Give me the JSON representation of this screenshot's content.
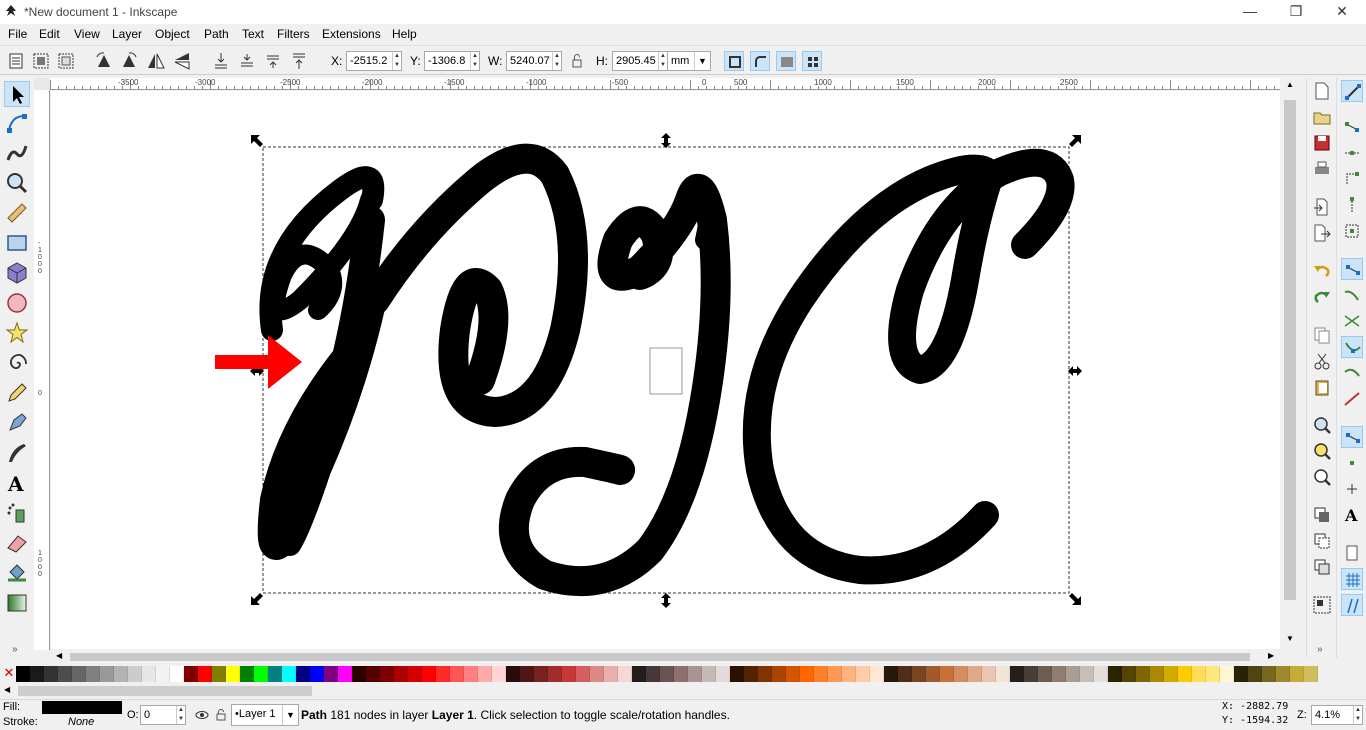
{
  "window": {
    "title": "*New document 1 - Inkscape",
    "minimize": "—",
    "maximize": "❐",
    "close": "✕"
  },
  "menu": [
    "File",
    "Edit",
    "View",
    "Layer",
    "Object",
    "Path",
    "Text",
    "Filters",
    "Extensions",
    "Help"
  ],
  "controls": {
    "x_label": "X:",
    "x_value": "-2515.2",
    "y_label": "Y:",
    "y_value": "-1306.8",
    "w_label": "W:",
    "w_value": "5240.07",
    "h_label": "H:",
    "h_value": "2905.45",
    "unit": "mm"
  },
  "ruler": {
    "h_labels": [
      "-3500",
      "-3000",
      "-2500",
      "-2000",
      "-1500",
      "-1000",
      "-500",
      "0",
      "500",
      "1000",
      "1500",
      "2000",
      "2500"
    ],
    "v_labels": [
      "-1000",
      "0",
      "1000"
    ]
  },
  "canvas": {
    "glyph_color": "#000000",
    "arrow_color": "#ff0000"
  },
  "palette": {
    "none_symbol": "✕",
    "colors": [
      "#000000",
      "#1a1a1a",
      "#333333",
      "#4d4d4d",
      "#666666",
      "#808080",
      "#999999",
      "#b3b3b3",
      "#cccccc",
      "#e6e6e6",
      "#f2f2f2",
      "#ffffff",
      "#800000",
      "#ff0000",
      "#808000",
      "#ffff00",
      "#008000",
      "#00ff00",
      "#008080",
      "#00ffff",
      "#000080",
      "#0000ff",
      "#800080",
      "#ff00ff",
      "#2b0000",
      "#550000",
      "#800000",
      "#aa0000",
      "#d40000",
      "#ff0000",
      "#ff2a2a",
      "#ff5555",
      "#ff8080",
      "#ffaaaa",
      "#ffd5d5",
      "#280b0b",
      "#501616",
      "#782121",
      "#a02c2c",
      "#c83737",
      "#d35f5f",
      "#de8787",
      "#e9afaf",
      "#f4d7d7",
      "#241c1c",
      "#483737",
      "#6c5353",
      "#916f6f",
      "#ac9393",
      "#c8b7b7",
      "#e3dbdb",
      "#2b1100",
      "#552200",
      "#803300",
      "#aa4400",
      "#d45500",
      "#ff6600",
      "#ff7f2a",
      "#ff9955",
      "#ffb380",
      "#ffccaa",
      "#ffe6d5",
      "#28170b",
      "#502d16",
      "#784421",
      "#a05a2c",
      "#c87137",
      "#d38d5f",
      "#deaa87",
      "#e9c6af",
      "#f4e3d7",
      "#241f1c",
      "#483e37",
      "#6c5d53",
      "#917c6f",
      "#ac9d93",
      "#c8beb7",
      "#e3dedb",
      "#2b2200",
      "#554400",
      "#806600",
      "#aa8800",
      "#d4aa00",
      "#ffcc00",
      "#ffdd55",
      "#ffe680",
      "#fff6d5",
      "#28220b",
      "#504416",
      "#786721",
      "#a0892c",
      "#c8ab37",
      "#d3bc5f"
    ]
  },
  "status": {
    "fill_label": "Fill:",
    "fill_color": "#000000",
    "stroke_label": "Stroke:",
    "stroke_value": "None",
    "opacity_label": "O:",
    "opacity_value": "0",
    "layer_name": "•Layer 1",
    "message_bold": "Path",
    "message_rest": " 181 nodes in layer ",
    "message_layer": "Layer 1",
    "message_end": ". Click selection to toggle scale/rotation handles.",
    "cursor_x": "X: -2882.79",
    "cursor_y": "Y: -1594.32",
    "zoom_label": "Z:",
    "zoom_value": "4.1%"
  }
}
